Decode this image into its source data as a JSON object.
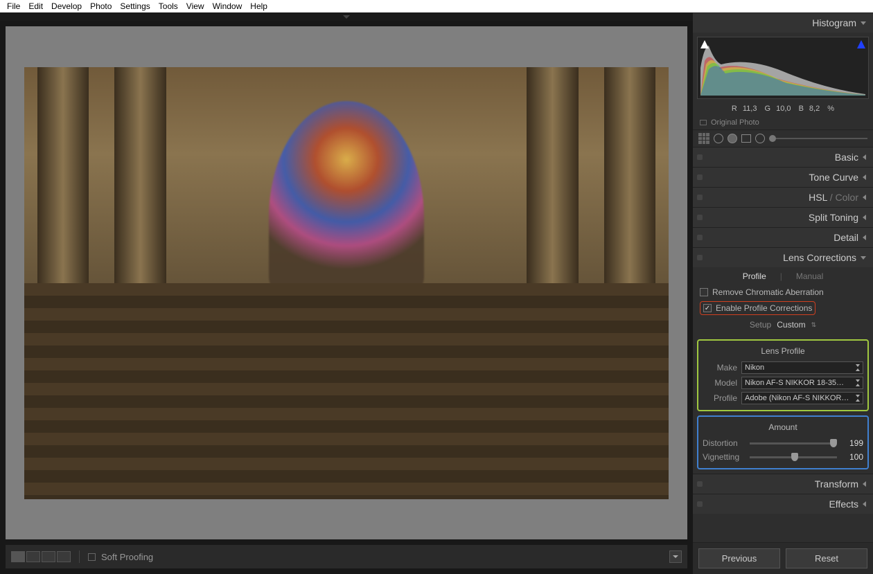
{
  "menu": [
    "File",
    "Edit",
    "Develop",
    "Photo",
    "Settings",
    "Tools",
    "View",
    "Window",
    "Help"
  ],
  "panels": {
    "histogram": "Histogram",
    "basic": "Basic",
    "toneCurve": "Tone Curve",
    "hsl": "HSL",
    "color": "Color",
    "splitToning": "Split Toning",
    "detail": "Detail",
    "lensCorrections": "Lens Corrections",
    "transform": "Transform",
    "effects": "Effects"
  },
  "histogram": {
    "r_label": "R",
    "r": "11,3",
    "g_label": "G",
    "g": "10,0",
    "b_label": "B",
    "b": "8,2",
    "pct": "%",
    "originalPhoto": "Original Photo"
  },
  "lens": {
    "tabProfile": "Profile",
    "tabManual": "Manual",
    "removeCA": "Remove Chromatic Aberration",
    "enableProfile": "Enable Profile Corrections",
    "setupLabel": "Setup",
    "setupValue": "Custom",
    "lensProfile": "Lens Profile",
    "makeLabel": "Make",
    "makeValue": "Nikon",
    "modelLabel": "Model",
    "modelValue": "Nikon AF-S NIKKOR 18-35…",
    "profileLabel": "Profile",
    "profileValue": "Adobe (Nikon AF-S NIKKOR…",
    "amount": "Amount",
    "distortionLabel": "Distortion",
    "distortionValue": "199",
    "vignettingLabel": "Vignetting",
    "vignettingValue": "100"
  },
  "buttons": {
    "previous": "Previous",
    "reset": "Reset"
  },
  "toolbar": {
    "softProofing": "Soft Proofing"
  }
}
